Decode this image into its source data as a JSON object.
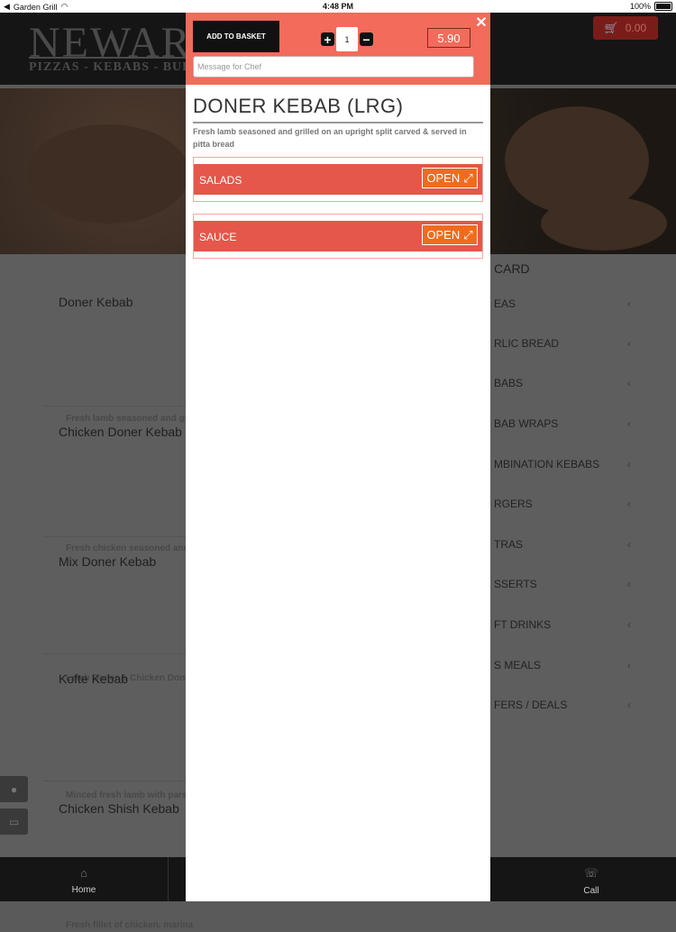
{
  "status_bar": {
    "carrier": "Garden Grill",
    "time": "4:48 PM",
    "battery": "100%"
  },
  "header": {
    "logo_main": "NEWAR",
    "logo_sub": "PIZZAS - KEBABS - BUR",
    "cart_total": "0.00"
  },
  "menu_items": [
    {
      "name": "Doner Kebab",
      "desc": "Fresh lamb seasoned and gril bread"
    },
    {
      "name": "Chicken Doner Kebab",
      "desc": "Fresh chicken seasoned and g bread"
    },
    {
      "name": "Mix Doner Kebab",
      "desc": "Lamb Doner & Chicken Doner"
    },
    {
      "name": "Kofte Kebab",
      "desc": "Minced fresh lamb with parsl on a flame grill"
    },
    {
      "name": "Chicken Shish Kebab",
      "desc": "Fresh fillet of chicken, marina"
    }
  ],
  "sidebar": {
    "title": "CARD",
    "categories": [
      "EAS",
      "RLIC BREAD",
      "BABS",
      "BAB WRAPS",
      "MBINATION KEBABS",
      "RGERS",
      "TRAS",
      "SSERTS",
      "FT DRINKS",
      "S MEALS",
      "FERS / DEALS"
    ]
  },
  "bottom_nav": {
    "home": "Home",
    "call": "Call"
  },
  "modal": {
    "add_to_basket": "ADD TO BASKET",
    "quantity": "1",
    "price": "5.90",
    "chef_placeholder": "Message for Chef",
    "title": "DONER KEBAB (LRG)",
    "description": "Fresh lamb seasoned and grilled on an upright split carved & served in pitta bread",
    "options": [
      {
        "label": "SALADS",
        "button": "OPEN"
      },
      {
        "label": "SAUCE",
        "button": "OPEN"
      }
    ]
  },
  "colors": {
    "accent": "#f26b5b",
    "option_bar": "#e4574a",
    "open_button": "#f26b1d"
  }
}
